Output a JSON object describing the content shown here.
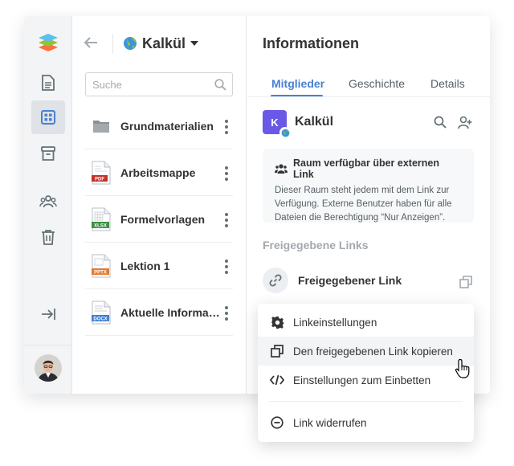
{
  "sidebar": {
    "items": [
      {
        "name": "documents-icon"
      },
      {
        "name": "rooms-icon",
        "active": true
      },
      {
        "name": "archive-icon"
      },
      {
        "name": "contacts-icon"
      },
      {
        "name": "trash-icon"
      },
      {
        "name": "logout-icon"
      }
    ]
  },
  "file_panel": {
    "room_title": "Kalkül",
    "search_placeholder": "Suche",
    "items": [
      {
        "name": "Grundmaterialien",
        "type": "folder"
      },
      {
        "name": "Arbeitsmappe",
        "type": "PDF"
      },
      {
        "name": "Formelvorlagen",
        "type": "XLSX"
      },
      {
        "name": "Lektion 1",
        "type": "PPTX"
      },
      {
        "name": "Aktuelle Informationen",
        "type": "DOCX"
      }
    ]
  },
  "info_panel": {
    "title": "Informationen",
    "tabs": [
      {
        "label": "Mitglieder",
        "active": true
      },
      {
        "label": "Geschichte"
      },
      {
        "label": "Details"
      }
    ],
    "room": {
      "initial": "K",
      "name": "Kalkül",
      "color": "#6a59e6"
    },
    "notice": {
      "title": "Raum verfügbar über externen Link",
      "body": "Dieser Raum steht jedem mit dem Link zur Verfügung. Externe Benutzer haben für alle Dateien die Berechtigung “Nur Anzeigen”."
    },
    "section_label": "Freigegebene Links",
    "link_name": "Freigegebener Link"
  },
  "context_menu": {
    "items": [
      {
        "label": "Linkeinstellungen",
        "icon": "gear-icon"
      },
      {
        "label": "Den freigegebenen Link kopieren",
        "icon": "copy-icon",
        "hover": true
      },
      {
        "label": "Einstellungen zum Einbetten",
        "icon": "code-icon"
      },
      {
        "label": "Link widerrufen",
        "icon": "revoke-icon"
      }
    ]
  },
  "colors": {
    "accent": "#4781d1",
    "room_badge": "#6a59e6"
  }
}
